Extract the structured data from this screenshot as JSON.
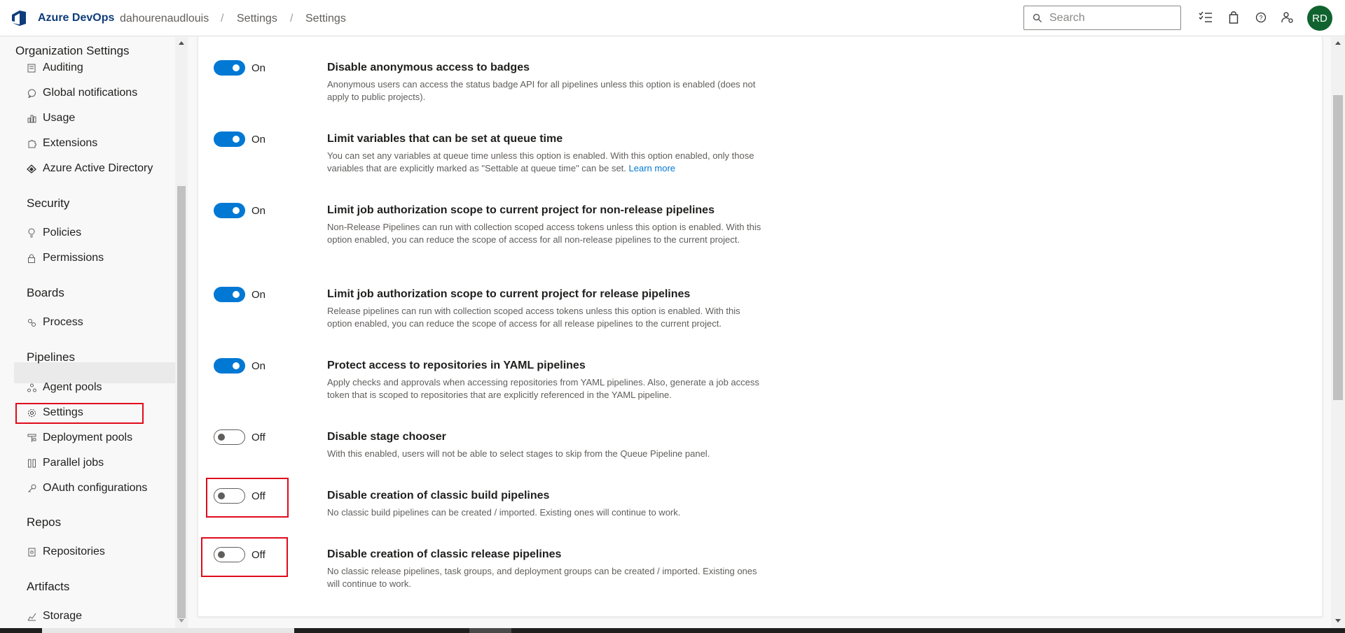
{
  "header": {
    "brand": "Azure DevOps",
    "breadcrumbs": [
      "dahourenaudlouis",
      "Settings",
      "Settings"
    ],
    "search_placeholder": "Search",
    "avatar_initials": "RD",
    "icons": [
      "task-list-icon",
      "shopping-bag-icon",
      "help-icon",
      "user-settings-icon"
    ]
  },
  "sidebar": {
    "title": "Organization Settings",
    "items": [
      {
        "label": "Auditing",
        "icon": "auditing-icon"
      },
      {
        "label": "Global notifications",
        "icon": "chat-icon"
      },
      {
        "label": "Usage",
        "icon": "usage-icon"
      },
      {
        "label": "Extensions",
        "icon": "puzzle-icon"
      },
      {
        "label": "Azure Active Directory",
        "icon": "aad-icon"
      }
    ],
    "sections": {
      "security": "Security",
      "boards": "Boards",
      "pipelines": "Pipelines",
      "repos": "Repos",
      "artifacts": "Artifacts"
    },
    "security_items": [
      {
        "label": "Policies",
        "icon": "lightbulb-icon"
      },
      {
        "label": "Permissions",
        "icon": "lock-icon"
      }
    ],
    "boards_items": [
      {
        "label": "Process",
        "icon": "process-icon"
      }
    ],
    "pipelines_items": [
      {
        "label": "Agent pools",
        "icon": "agent-pool-icon"
      },
      {
        "label": "Settings",
        "icon": "gear-icon",
        "active": true
      },
      {
        "label": "Deployment pools",
        "icon": "deployment-pool-icon"
      },
      {
        "label": "Parallel jobs",
        "icon": "parallel-jobs-icon"
      },
      {
        "label": "OAuth configurations",
        "icon": "key-icon"
      }
    ],
    "repos_items": [
      {
        "label": "Repositories",
        "icon": "repo-icon"
      }
    ],
    "artifacts_items": [
      {
        "label": "Storage",
        "icon": "storage-icon"
      }
    ]
  },
  "settings": [
    {
      "state": "On",
      "title": "Disable anonymous access to badges",
      "description": "Anonymous users can access the status badge API for all pipelines unless this option is enabled (does not apply to public projects).",
      "link": ""
    },
    {
      "state": "On",
      "title": "Limit variables that can be set at queue time",
      "description": "You can set any variables at queue time unless this option is enabled. With this option enabled, only those variables that are explicitly marked as \"Settable at queue time\" can be set.",
      "link": "Learn more"
    },
    {
      "state": "On",
      "title": "Limit job authorization scope to current project for non-release pipelines",
      "description": "Non-Release Pipelines can run with collection scoped access tokens unless this option is enabled. With this option enabled, you can reduce the scope of access for all non-release pipelines to the current project.",
      "link": ""
    },
    {
      "state": "On",
      "title": "Limit job authorization scope to current project for release pipelines",
      "description": "Release pipelines can run with collection scoped access tokens unless this option is enabled. With this option enabled, you can reduce the scope of access for all release pipelines to the current project.",
      "link": ""
    },
    {
      "state": "On",
      "title": "Protect access to repositories in YAML pipelines",
      "description": "Apply checks and approvals when accessing repositories from YAML pipelines. Also, generate a job access token that is scoped to repositories that are explicitly referenced in the YAML pipeline.",
      "link": ""
    },
    {
      "state": "Off",
      "title": "Disable stage chooser",
      "description": "With this enabled, users will not be able to select stages to skip from the Queue Pipeline panel.",
      "link": ""
    },
    {
      "state": "Off",
      "title": "Disable creation of classic build pipelines",
      "description": "No classic build pipelines can be created / imported. Existing ones will continue to work.",
      "link": ""
    },
    {
      "state": "Off",
      "title": "Disable creation of classic release pipelines",
      "description": "No classic release pipelines, task groups, and deployment groups can be created / imported. Existing ones will continue to work.",
      "link": ""
    }
  ],
  "colors": {
    "accent": "#0078d4",
    "brand": "#0f3d7a",
    "highlight": "#e00b1c",
    "avatar": "#10632f"
  }
}
